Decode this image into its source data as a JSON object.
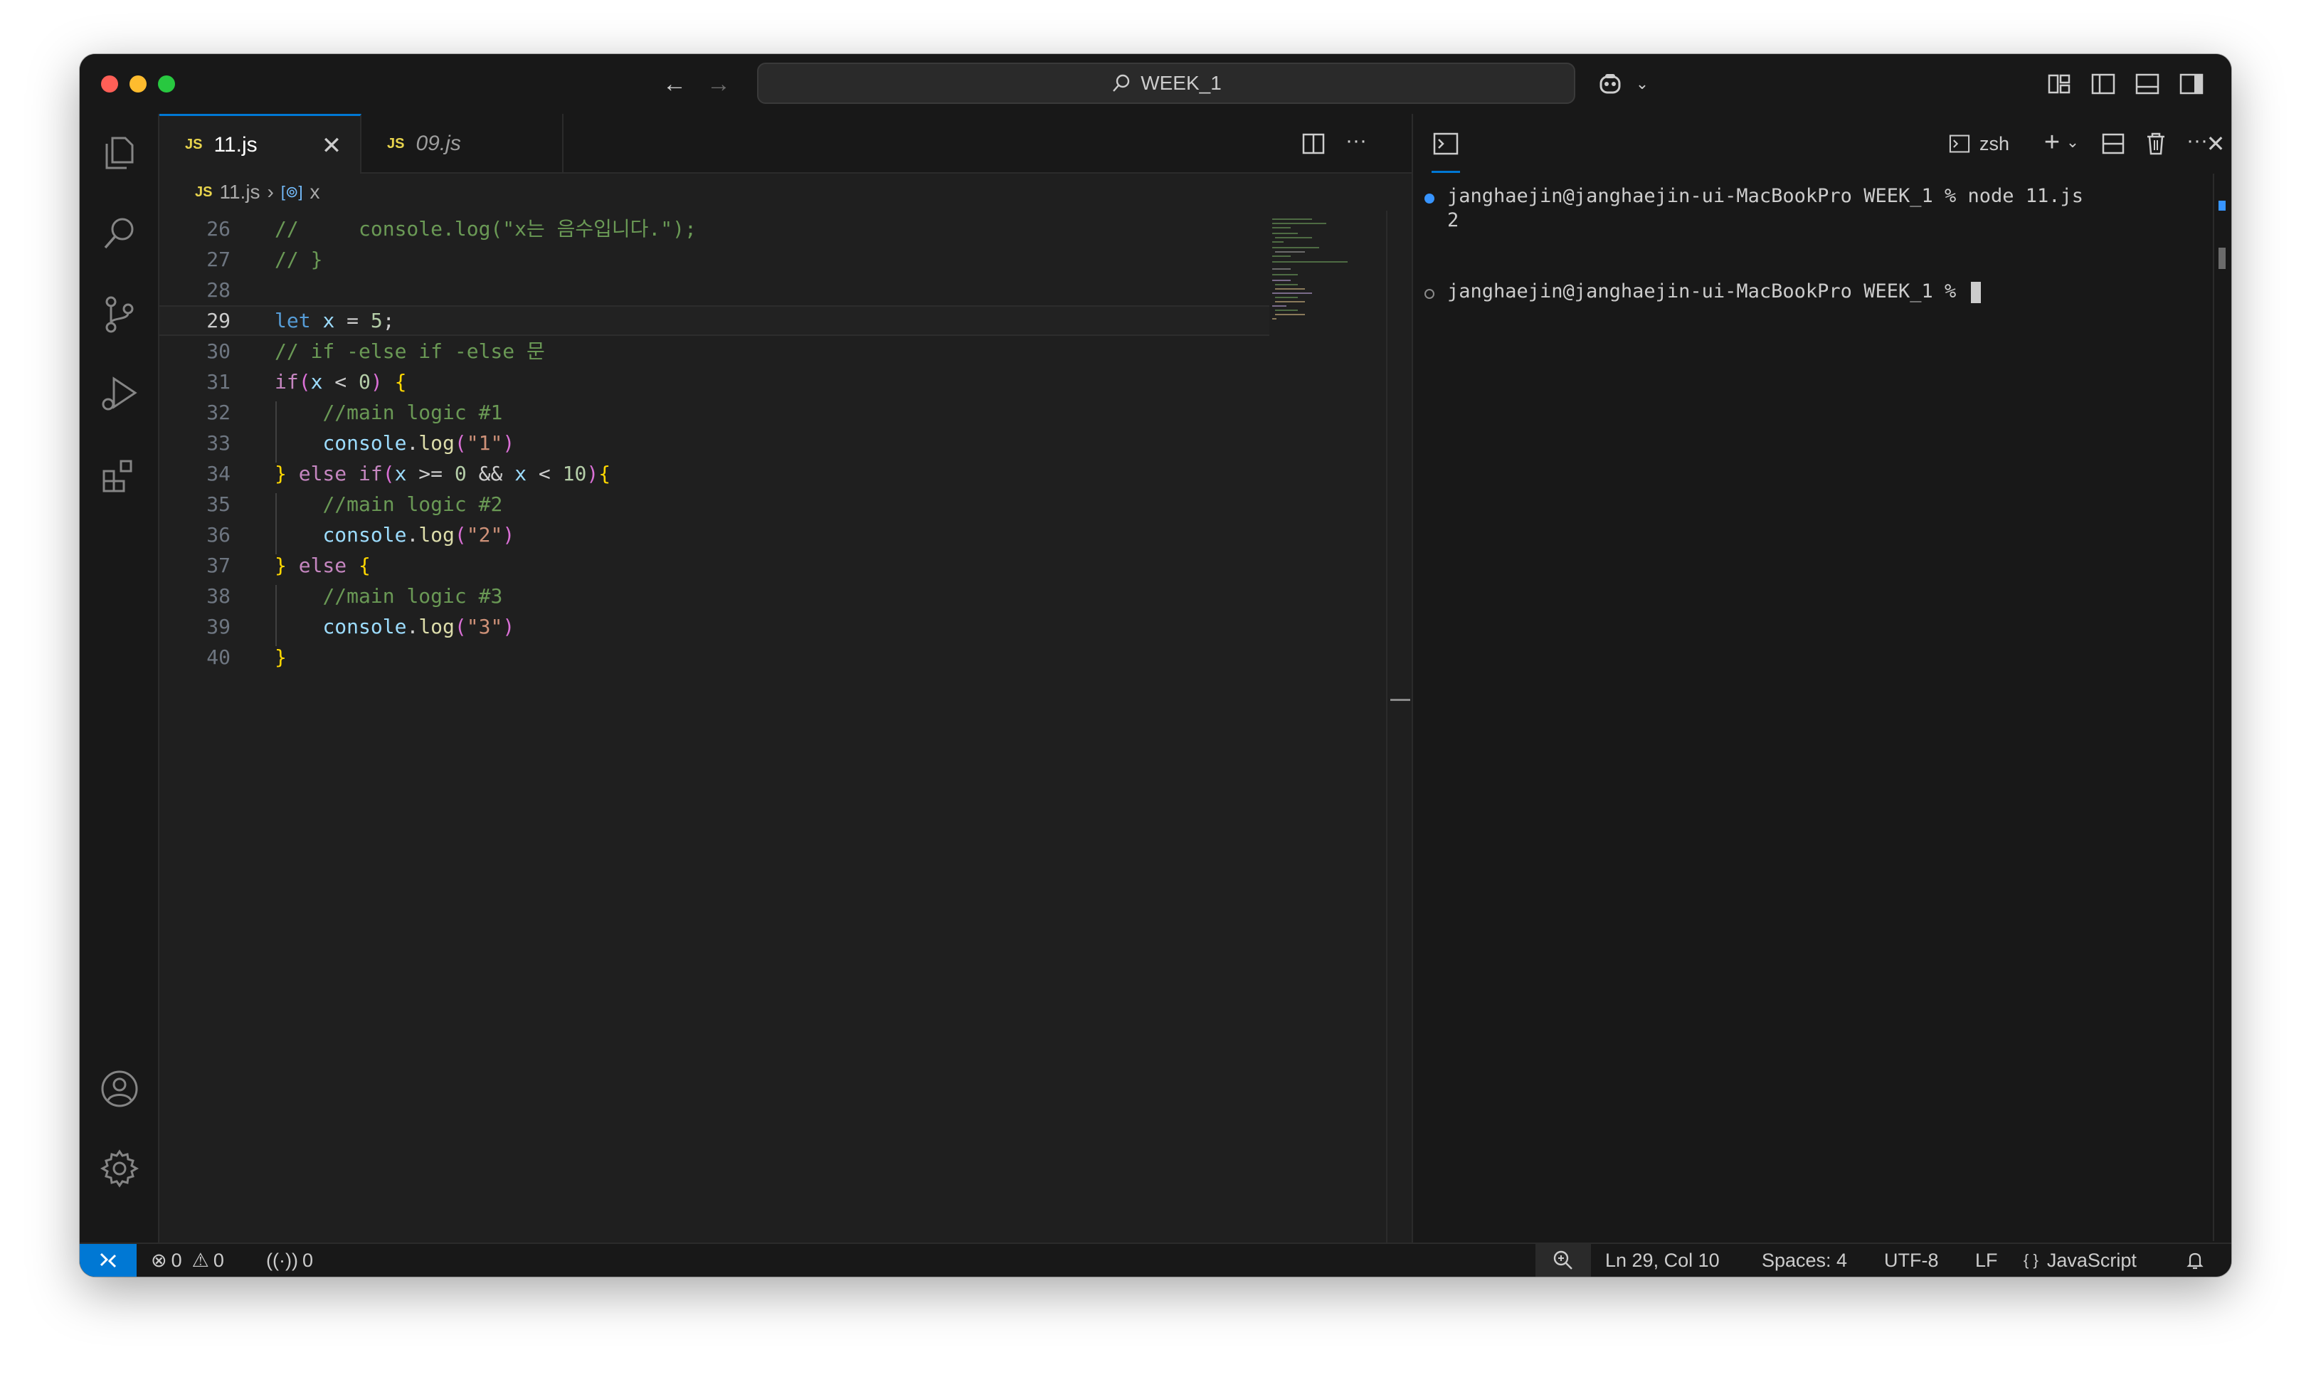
{
  "window": {
    "search_text": "WEEK_1"
  },
  "tabs": [
    {
      "icon": "JS",
      "label": "11.js",
      "active": true
    },
    {
      "icon": "JS",
      "label": "09.js",
      "active": false
    }
  ],
  "breadcrumb": {
    "icon": "JS",
    "file": "11.js",
    "symbol": "x"
  },
  "editor": {
    "lines": [
      {
        "n": "26"
      },
      {
        "n": "27"
      },
      {
        "n": "28"
      },
      {
        "n": "29"
      },
      {
        "n": "30"
      },
      {
        "n": "31"
      },
      {
        "n": "32"
      },
      {
        "n": "33"
      },
      {
        "n": "34"
      },
      {
        "n": "35"
      },
      {
        "n": "36"
      },
      {
        "n": "37"
      },
      {
        "n": "38"
      },
      {
        "n": "39"
      },
      {
        "n": "40"
      }
    ],
    "code": {
      "l26": "//     console.log(\"x는 음수입니다.\");",
      "l27": "// }",
      "l30": "// if -else if -else 문",
      "l32": "//main logic #1",
      "l35": "//main logic #2",
      "l38": "//main logic #3",
      "let": "let",
      "if": "if",
      "else": "else",
      "x": "x",
      "console": "console",
      "log": "log",
      "s1": "\"1\"",
      "s2": "\"2\"",
      "s3": "\"3\"",
      "n5": "5",
      "n0": "0",
      "n10": "10"
    }
  },
  "terminal": {
    "shell_label": "zsh",
    "lines": [
      "janghaejin@janghaejin-ui-MacBookPro WEEK_1 % node 11.js",
      "2",
      "janghaejin@janghaejin-ui-MacBookPro WEEK_1 % "
    ]
  },
  "statusbar": {
    "errors": "0",
    "warnings": "0",
    "ports": "0",
    "position": "Ln 29, Col 10",
    "spaces": "Spaces: 4",
    "encoding": "UTF-8",
    "eol": "LF",
    "language_icon": "{ }",
    "language": "JavaScript"
  },
  "colors": {
    "accent": "#0078d4",
    "background": "#1f1f1f",
    "chrome": "#181818"
  }
}
